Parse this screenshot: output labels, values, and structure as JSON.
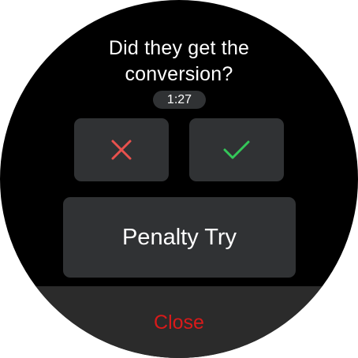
{
  "dialog": {
    "question": "Did they get the conversion?",
    "timer": "1:27"
  },
  "actions": {
    "no_icon": "close-x-icon",
    "yes_icon": "check-icon",
    "penalty_label": "Penalty Try",
    "close_label": "Close"
  },
  "colors": {
    "background": "#000000",
    "button": "#303234",
    "no_accent": "#e8514d",
    "yes_accent": "#34c759",
    "close_text": "#d91a1a",
    "close_bar": "#2b2b2b"
  }
}
